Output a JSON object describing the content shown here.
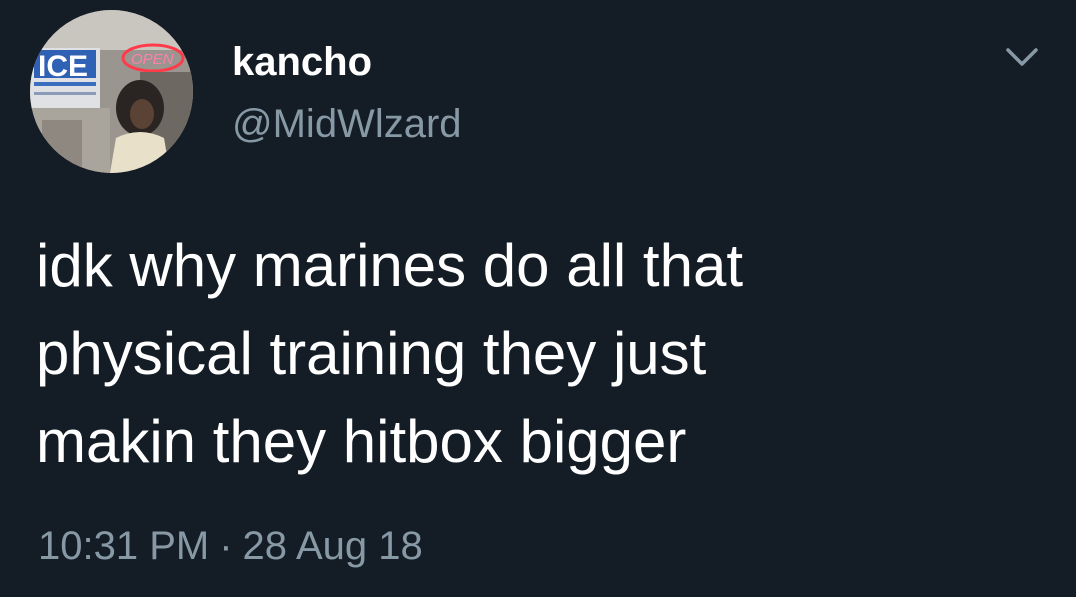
{
  "user": {
    "display_name": "kancho",
    "handle": "@MidWlzard",
    "avatar": {
      "sign_text": "ICE",
      "neon_text": "OPEN"
    }
  },
  "tweet": {
    "lines": [
      "idk why marines do all that",
      "physical training they just",
      "makin they hitbox bigger"
    ],
    "time": "10:31 PM",
    "separator": "·",
    "date": "28 Aug 18"
  },
  "icons": {
    "menu": "chevron-down-icon"
  },
  "colors": {
    "background": "#141d26",
    "primary_text": "#ffffff",
    "secondary_text": "#8899a6"
  }
}
